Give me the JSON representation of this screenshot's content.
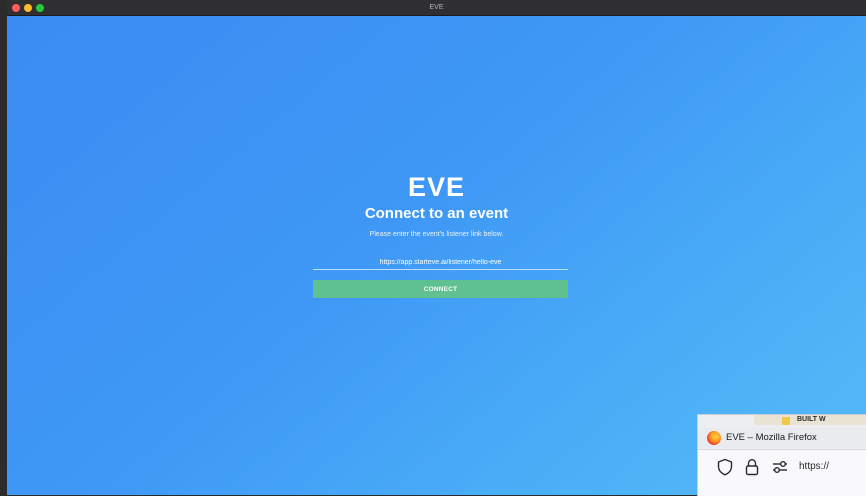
{
  "window": {
    "title": "EVE"
  },
  "connect": {
    "logo": "EVE",
    "heading": "Connect to an event",
    "subtext": "Please enter the event's listener link below.",
    "link_value": "https://app.starteve.ai/listener/hello-eve",
    "button_label": "CONNECT"
  },
  "firefox": {
    "window_title": "EVE – Mozilla Firefox",
    "url_partial": "https://",
    "behind_text": "BUILT W"
  },
  "colors": {
    "background_gradient_start": "#3b8cf2",
    "background_gradient_end": "#56baf7",
    "connect_button": "#5fc18f",
    "titlebar": "#2f2f31"
  },
  "icons": {
    "traffic_lights": [
      "close-icon",
      "minimize-icon",
      "maximize-icon"
    ],
    "firefox": [
      "firefox-logo-icon",
      "tracking-shield-icon",
      "lock-icon",
      "permissions-icon"
    ]
  }
}
